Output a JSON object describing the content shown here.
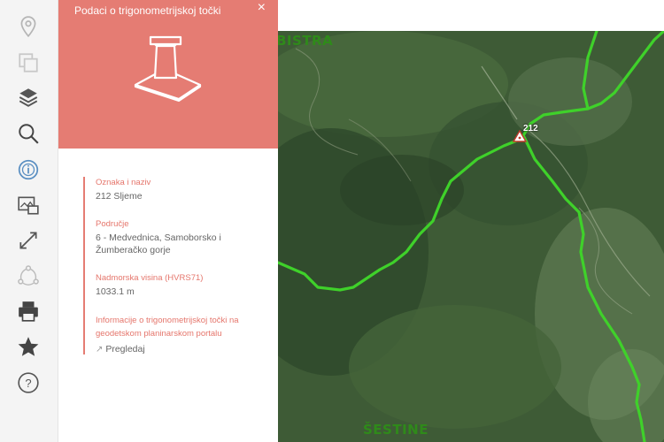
{
  "toolbar": {
    "items": [
      {
        "name": "location-icon"
      },
      {
        "name": "layers-copy-icon"
      },
      {
        "name": "layers-icon"
      },
      {
        "name": "search-icon"
      },
      {
        "name": "info-icon"
      },
      {
        "name": "map-print-icon"
      },
      {
        "name": "fullscreen-icon"
      },
      {
        "name": "share-icon"
      },
      {
        "name": "printer-icon"
      },
      {
        "name": "star-icon"
      },
      {
        "name": "help-icon"
      }
    ],
    "help_label": "?"
  },
  "panel": {
    "title": "Podaci o trigonometrijskoj točki",
    "close_label": "×",
    "accent_color": "#e57c73",
    "fields": [
      {
        "label": "Oznaka i naziv",
        "value": "212 Sljeme"
      },
      {
        "label": "Područje",
        "value": "6 - Medvednica, Samoborsko i Žumberačko gorje"
      },
      {
        "label": "Nadmorska visina (HVRS71)",
        "value": "1033.1 m"
      }
    ],
    "portal_label": "Informacije o trigonometrijskoj točki na geodetskom planinarskom portalu",
    "portal_link": "Pregledaj"
  },
  "map": {
    "place_top": "BISTRA",
    "place_bottom": "ŠESTINE",
    "trig_point_label": "212",
    "boundary_color": "#3fd12a"
  }
}
